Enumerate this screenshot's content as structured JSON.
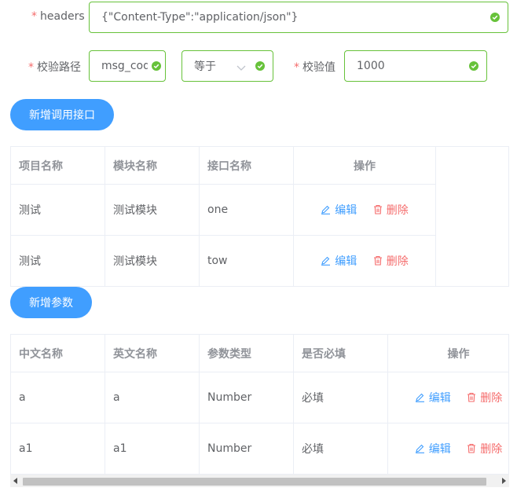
{
  "form": {
    "headers_label": "headers",
    "headers_value": "{\"Content-Type\":\"application/json\"}",
    "check_path_label": "校验路径",
    "check_path_value": "msg_code",
    "operator_value": "等于",
    "check_value_label": "校验值",
    "check_value_value": "1000"
  },
  "buttons": {
    "add_interface": "新增调用接口",
    "add_param": "新增参数"
  },
  "interface_table": {
    "headers": [
      "项目名称",
      "模块名称",
      "接口名称",
      "操作"
    ],
    "rows": [
      {
        "project": "测试",
        "module": "测试模块",
        "interface": "one"
      },
      {
        "project": "测试",
        "module": "测试模块",
        "interface": "tow"
      }
    ]
  },
  "param_table": {
    "headers": [
      "中文名称",
      "英文名称",
      "参数类型",
      "是否必填",
      "操作"
    ],
    "rows": [
      {
        "cn": "a",
        "en": "a",
        "type": "Number",
        "required": "必填"
      },
      {
        "cn": "a1",
        "en": "a1",
        "type": "Number",
        "required": "必填"
      }
    ]
  },
  "actions": {
    "edit": "编辑",
    "delete": "删除"
  },
  "colors": {
    "primary": "#409eff",
    "success": "#67c23a",
    "danger": "#f56c6c"
  }
}
